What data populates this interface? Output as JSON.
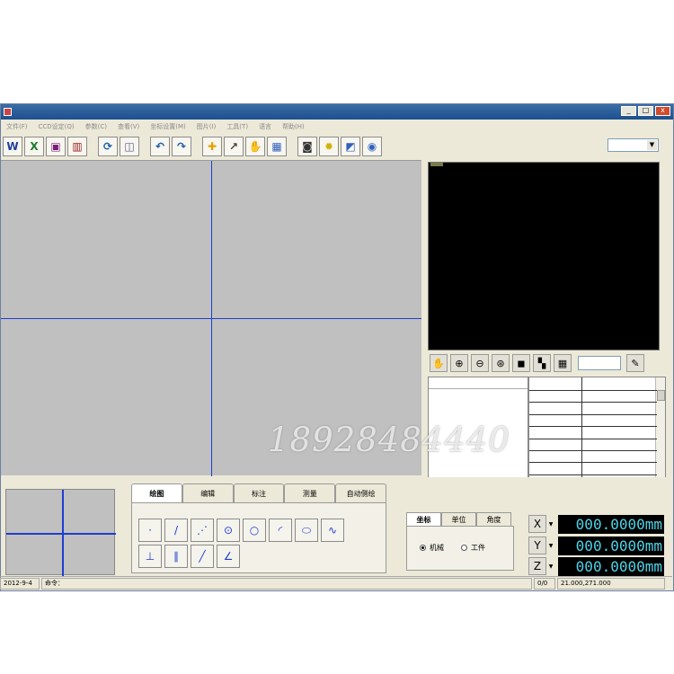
{
  "window": {
    "title": "",
    "controls": [
      "_",
      "□",
      "x"
    ]
  },
  "menu": {
    "items": [
      "文件(F)",
      "CCD设定(Q)",
      "参数(C)",
      "查看(V)",
      "坐标设置(M)",
      "图片(I)",
      "工具(T)",
      "语言",
      "帮助(H)"
    ]
  },
  "toolbar": {
    "buttons": [
      {
        "name": "word-export-icon",
        "glyph": "W",
        "color": "#1f3f9f"
      },
      {
        "name": "excel-export-icon",
        "glyph": "X",
        "color": "#1b7a2a"
      },
      {
        "name": "save-file-icon",
        "glyph": "▣",
        "color": "#7a1d7a"
      },
      {
        "name": "statistics-chart-icon",
        "glyph": "▥",
        "color": "#9a1b1b"
      },
      {
        "name": "refresh-icon",
        "glyph": "⟳",
        "color": "#1d5fa8"
      },
      {
        "name": "image-icon",
        "glyph": "◫",
        "color": "#5a5a8a"
      },
      {
        "name": "undo-icon",
        "glyph": "↶",
        "color": "#1d5fa8"
      },
      {
        "name": "redo-icon",
        "glyph": "↷",
        "color": "#1d5fa8"
      },
      {
        "name": "crosshair-icon",
        "glyph": "✚",
        "color": "#e6a100"
      },
      {
        "name": "pick-tool-icon",
        "glyph": "↗",
        "color": "#444444"
      },
      {
        "name": "hand-pan-icon",
        "glyph": "✋",
        "color": "#444444"
      },
      {
        "name": "grid-icon",
        "glyph": "▦",
        "color": "#3060c0"
      },
      {
        "name": "camera-icon",
        "glyph": "◙",
        "color": "#333333"
      },
      {
        "name": "light-bulb-icon",
        "glyph": "✹",
        "color": "#d0b000"
      },
      {
        "name": "picture-frame-icon",
        "glyph": "◩",
        "color": "#3060c0"
      },
      {
        "name": "disc-settings-icon",
        "glyph": "◉",
        "color": "#3060c0"
      }
    ],
    "combo_value": ""
  },
  "watermark": "18928484440",
  "tabs": [
    "绘图",
    "编辑",
    "标注",
    "测量",
    "自动侧绘"
  ],
  "active_tab": 0,
  "draw_tools": [
    {
      "name": "point-tool-icon",
      "glyph": "·"
    },
    {
      "name": "line-tool-icon",
      "glyph": "/"
    },
    {
      "name": "dotted-line-tool-icon",
      "glyph": "⋰"
    },
    {
      "name": "circle-center-tool-icon",
      "glyph": "⊙"
    },
    {
      "name": "circle-tool-icon",
      "glyph": "○"
    },
    {
      "name": "arc-tool-icon",
      "glyph": "◜"
    },
    {
      "name": "ellipse-tool-icon",
      "glyph": "⬭"
    },
    {
      "name": "curve-tool-icon",
      "glyph": "∿"
    },
    {
      "name": "perpendicular-tool-icon",
      "glyph": "⊥"
    },
    {
      "name": "parallel-lines-tool-icon",
      "glyph": "∥"
    },
    {
      "name": "slant-line-tool-icon",
      "glyph": "╱"
    },
    {
      "name": "angle-tool-icon",
      "glyph": "∠"
    }
  ],
  "coord_panel": {
    "tabs": [
      "坐标",
      "单位",
      "角度"
    ],
    "active_tab": 0,
    "radio_machine": "机械",
    "radio_work": "工件",
    "selected": "machine"
  },
  "dro": {
    "x_label": "X",
    "y_label": "Y",
    "z_label": "Z",
    "x_value": "000.0000mm",
    "y_value": "000.0000mm",
    "z_value": "000.0000mm"
  },
  "status": {
    "date": "2012-9-4",
    "command_label": "命令：",
    "count": "0/0",
    "coords": "21.000,271.000"
  }
}
